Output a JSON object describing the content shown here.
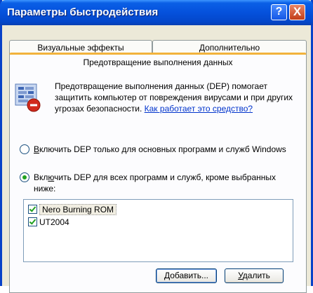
{
  "window": {
    "title": "Параметры быстродействия",
    "help_glyph": "?",
    "close_glyph": "X"
  },
  "tabs": [
    {
      "label": "Визуальные эффекты"
    },
    {
      "label": "Дополнительно"
    },
    {
      "label": "Предотвращение выполнения данных",
      "selected": true
    }
  ],
  "description": {
    "text": "Предотвращение выполнения данных (DEP) помогает защитить компьютер от повреждения вирусами и при других угрозах безопасности. ",
    "link": "Как работает это средство?"
  },
  "options": [
    {
      "prefix": "",
      "underlined": "В",
      "rest": "ключить DEP только для основных программ и служб Windows",
      "selected": false
    },
    {
      "prefix": "Вкл",
      "underlined": "ю",
      "rest": "чить DEP для всех программ и служб, кроме выбранных ниже:",
      "selected": true
    }
  ],
  "programs": [
    {
      "name": "Nero Burning ROM",
      "checked": true,
      "selected": true
    },
    {
      "name": "UT2004",
      "checked": true,
      "selected": false
    }
  ],
  "buttons": {
    "add": {
      "underlined": "Д",
      "rest": "обавить..."
    },
    "remove": {
      "underlined": "У",
      "rest": "далить"
    }
  },
  "colors": {
    "titlebar": "#0551dc",
    "selected_tab_accent": "#f2b33c",
    "link": "#0033cc",
    "radio_dot": "#21a121"
  }
}
